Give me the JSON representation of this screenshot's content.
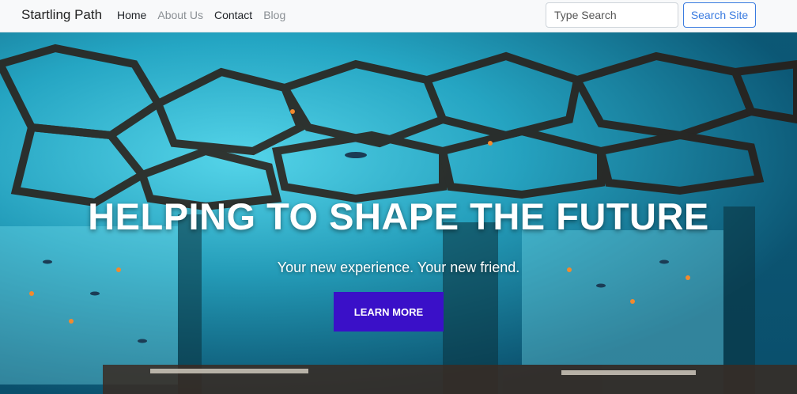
{
  "navbar": {
    "brand": "Startling Path",
    "links": [
      {
        "label": "Home",
        "active": true
      },
      {
        "label": "About Us",
        "active": false
      },
      {
        "label": "Contact",
        "active": false
      },
      {
        "label": "Blog",
        "active": false
      }
    ],
    "search": {
      "placeholder": "Type Search",
      "button_label": "Search Site"
    }
  },
  "hero": {
    "title": "HELPING TO SHAPE THE FUTURE",
    "subtitle": "Your new experience. Your new friend.",
    "button_label": "LEARN MORE"
  },
  "colors": {
    "accent_blue": "#3a7be0",
    "cta_purple": "#3a10c8",
    "aquarium_cyan": "#2cc8e0"
  }
}
